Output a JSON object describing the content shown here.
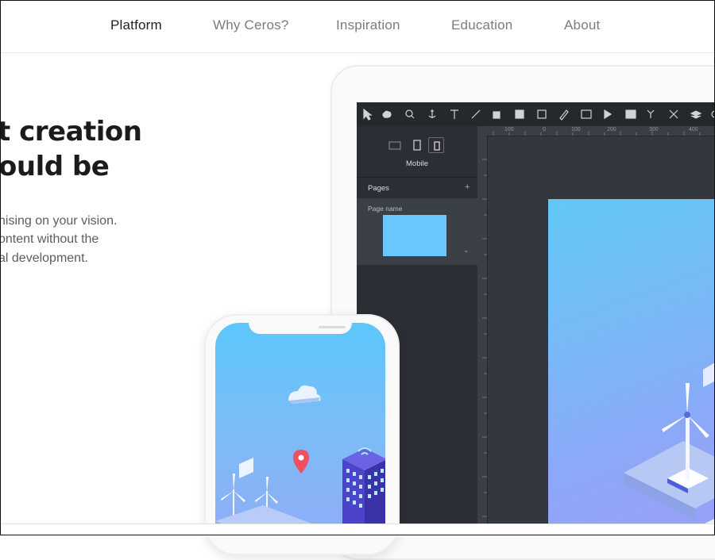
{
  "nav": {
    "items": [
      {
        "label": "Platform",
        "active": true
      },
      {
        "label": "Why Ceros?",
        "active": false
      },
      {
        "label": "Inspiration",
        "active": false
      },
      {
        "label": "Education",
        "active": false
      },
      {
        "label": "About",
        "active": false
      }
    ]
  },
  "hero": {
    "title_line1": "t creation",
    "title_line2": "ould be",
    "body_line1": "nising on your vision.",
    "body_line2": "ontent without the",
    "body_line3": "al development."
  },
  "editor": {
    "device_label": "Mobile",
    "pages_label": "Pages",
    "pages_add": "+",
    "page_name": "Page name",
    "ruler_top": [
      "100",
      "0",
      "100",
      "200",
      "300",
      "400"
    ],
    "ruler_left": [
      "200",
      "100",
      "0",
      "100",
      "200",
      "300",
      "400",
      "500",
      "600",
      "700"
    ],
    "toolbar_icons": [
      "cursor-icon",
      "hand-icon",
      "zoom-icon",
      "anchor-icon",
      "text-icon",
      "line-icon",
      "shape-icon",
      "mask-icon",
      "frame-icon",
      "pen-icon",
      "image-icon",
      "video-icon",
      "embed-icon",
      "hotspot-icon",
      "tools-icon",
      "layers-icon"
    ]
  },
  "colors": {
    "accent": "#69c7fb",
    "editor_bg": "#2e3239",
    "text_dark": "#1b1b1b"
  }
}
